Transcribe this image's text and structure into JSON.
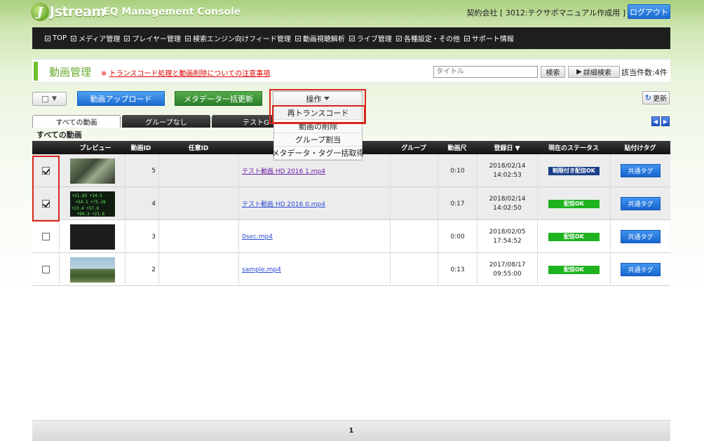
{
  "header": {
    "logo_text": "Jstream",
    "logo_j": "J",
    "console_title": "EQ Management Console",
    "contract_label": "契約会社 [ 3012:テクサポマニュアル作成用 ]",
    "logout_label": "ログアウト"
  },
  "nav": {
    "items": [
      {
        "label": "TOP"
      },
      {
        "label": "メディア管理"
      },
      {
        "label": "プレイヤー管理"
      },
      {
        "label": "検索エンジン向けフィード管理"
      },
      {
        "label": "動画視聴解析"
      },
      {
        "label": "ライブ管理"
      },
      {
        "label": "各種設定・その他"
      },
      {
        "label": "サポート情報"
      }
    ]
  },
  "title_bar": {
    "title": "動画管理",
    "notice_mark": "※",
    "notice_link": "トランスコード処理と動画削除についての注意事項",
    "search_placeholder": "タイトル",
    "search_label": "検索",
    "advanced_label": "詳細検索",
    "advanced_icon": "play-triangle-icon",
    "count_label": "該当件数:4件"
  },
  "toolbar": {
    "upload_label": "動画アップロード",
    "meta_label": "メタデータ一括更新",
    "operation_label": "操作",
    "refresh_label": "更新"
  },
  "dropdown": {
    "items": [
      {
        "label": "再トランスコード"
      },
      {
        "label": "動画の削除"
      },
      {
        "label": "グループ割当"
      },
      {
        "label": "メタデータ・タグ一括取得"
      }
    ]
  },
  "tabs": [
    {
      "label": "すべての動画"
    },
    {
      "label": "グループなし"
    },
    {
      "label": "テストG"
    }
  ],
  "section_label": "すべての動画",
  "table": {
    "headers": {
      "preview": "プレビュー",
      "id": "動画ID",
      "custom_id": "任意ID",
      "title": "",
      "group": "グループ",
      "duration": "動画尺",
      "date": "登録日 ▼",
      "status": "現在のステータス",
      "tag": "貼付けタグ"
    },
    "rows": [
      {
        "checked": true,
        "id": "5",
        "title": "テスト動画 HD 2016 1.mp4",
        "duration": "0:10",
        "date": "2018/02/14",
        "time": "14:02:53",
        "status": "制限付き配信OK",
        "tag": "共通タグ"
      },
      {
        "checked": true,
        "id": "4",
        "title": "テスト動画 HD 2016 0.mp4",
        "duration": "0:17",
        "date": "2018/02/14",
        "time": "14:02:50",
        "status": "配信OK",
        "tag": "共通タグ"
      },
      {
        "checked": false,
        "id": "3",
        "title": "0sec.mp4",
        "duration": "0:00",
        "date": "2018/02/05",
        "time": "17:54:52",
        "status": "配信OK",
        "tag": "共通タグ"
      },
      {
        "checked": false,
        "id": "2",
        "title": "sample.mp4",
        "duration": "0:13",
        "date": "2017/08/17",
        "time": "09:55:00",
        "status": "配信OK",
        "tag": "共通タグ"
      }
    ]
  },
  "pager": {
    "current": "1"
  },
  "colors": {
    "accent_green": "#6ec12f",
    "button_blue": "#1a6ad0",
    "status_ok": "#1fb21f",
    "status_limited": "#1a3f8a",
    "highlight_red": "#d9261c"
  }
}
